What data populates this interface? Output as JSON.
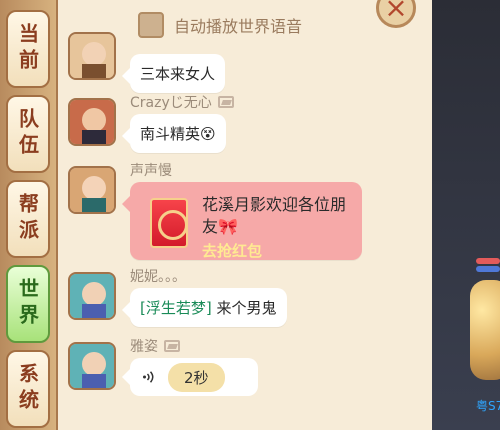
{
  "left_tabs": [
    {
      "label": "当前",
      "active": false
    },
    {
      "label": "队伍",
      "active": false
    },
    {
      "label": "帮派",
      "active": false
    },
    {
      "label": "世界",
      "active": true
    },
    {
      "label": "系统",
      "active": false
    }
  ],
  "header": {
    "auto_play_label": "自动播放世界语音",
    "close_icon": "close-icon"
  },
  "messages": [
    {
      "username": "",
      "text": "三本来女人"
    },
    {
      "username": "Crazyじ无心",
      "text": "南斗精英😵"
    },
    {
      "username": "声声慢",
      "red_packet_text": "花溪月影欢迎各位朋友🎀",
      "red_packet_action": "去抢红包"
    },
    {
      "username": "妮妮。。。",
      "tag": "[浮生若梦]",
      "text": "来个男鬼"
    },
    {
      "username": "雅姿",
      "voice_duration": "2秒"
    }
  ],
  "right_panel": {
    "server_text": "粤S7"
  },
  "colors": {
    "active_tab": "#a8e27a",
    "red_packet_bubble": "#f6a9a8",
    "tag_green": "#1a8b58"
  }
}
